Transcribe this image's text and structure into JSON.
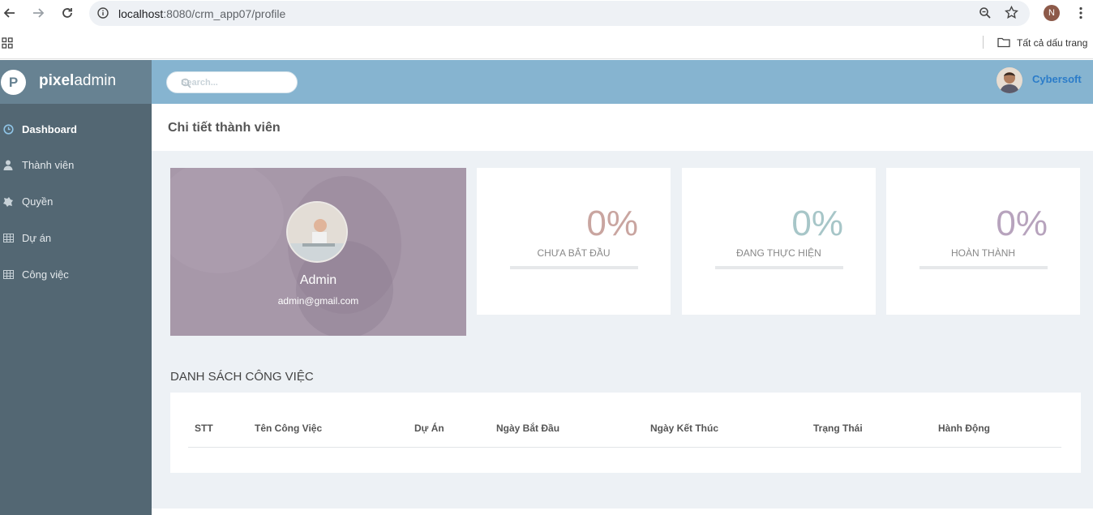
{
  "browser": {
    "url_host": "localhost",
    "url_rest": ":8080/crm_app07/profile",
    "profile_initial": "N",
    "bookmarks_label": "Tất cả dấu trang"
  },
  "app": {
    "logo_bold": "pixel",
    "logo_light": "admin",
    "logo_letter": "P",
    "search_placeholder": "Search...",
    "user_name": "Cybersoft"
  },
  "sidebar": {
    "items": [
      {
        "label": "Dashboard",
        "icon": "clock-icon"
      },
      {
        "label": "Thành viên",
        "icon": "user-icon"
      },
      {
        "label": "Quyền",
        "icon": "puzzle-icon"
      },
      {
        "label": "Dự án",
        "icon": "table-icon"
      },
      {
        "label": "Công việc",
        "icon": "table-icon"
      }
    ]
  },
  "page": {
    "title": "Chi tiết thành viên"
  },
  "profile": {
    "name": "Admin",
    "email": "admin@gmail.com"
  },
  "stats": [
    {
      "value": "0%",
      "label": "CHƯA BẮT ĐẦU",
      "color": "#c9a5a0"
    },
    {
      "value": "0%",
      "label": "ĐANG THỰC HIỆN",
      "color": "#a7c6c8"
    },
    {
      "value": "0%",
      "label": "HOÀN THÀNH",
      "color": "#b7a3bd"
    }
  ],
  "tasks": {
    "section_title": "DANH SÁCH CÔNG VIỆC",
    "columns": [
      "STT",
      "Tên Công Việc",
      "Dự Án",
      "Ngày Bắt Đầu",
      "Ngày Kết Thúc",
      "Trạng Thái",
      "Hành Động"
    ],
    "rows": []
  },
  "colors": {
    "sidebar": "#536773",
    "topbar": "#86b4d0",
    "accent": "#2b7cc9"
  }
}
